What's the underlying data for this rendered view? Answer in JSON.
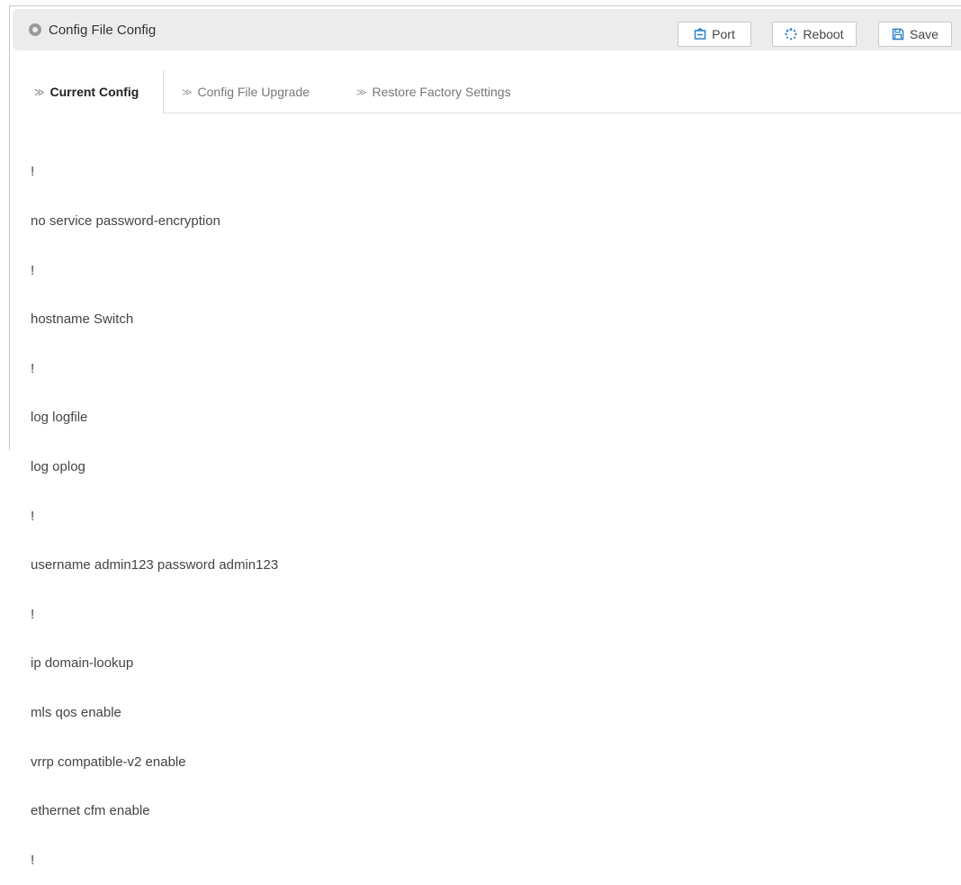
{
  "header": {
    "title": "Config File Config",
    "buttons": {
      "port": "Port",
      "reboot": "Reboot",
      "save": "Save"
    }
  },
  "tabs": [
    {
      "label": "Current Config",
      "active": true
    },
    {
      "label": "Config File Upgrade",
      "active": false
    },
    {
      "label": "Restore Factory Settings",
      "active": false
    }
  ],
  "config_lines": [
    "!",
    "no service password-encryption",
    "!",
    "hostname Switch",
    "!",
    "log logfile",
    "log oplog",
    "!",
    "username admin123 password admin123",
    "!",
    "ip domain-lookup",
    "mls qos enable",
    "vrrp compatible-v2 enable",
    "ethernet cfm enable",
    "!"
  ],
  "colors": {
    "header_bg": "#ececec",
    "icon_blue": "#2a7fc9",
    "text": "#444444"
  },
  "icons": {
    "title": "circle-dot-icon",
    "port": "port-icon",
    "reboot": "spinner-icon",
    "save": "floppy-icon",
    "tab": "chevron-right-icon"
  }
}
